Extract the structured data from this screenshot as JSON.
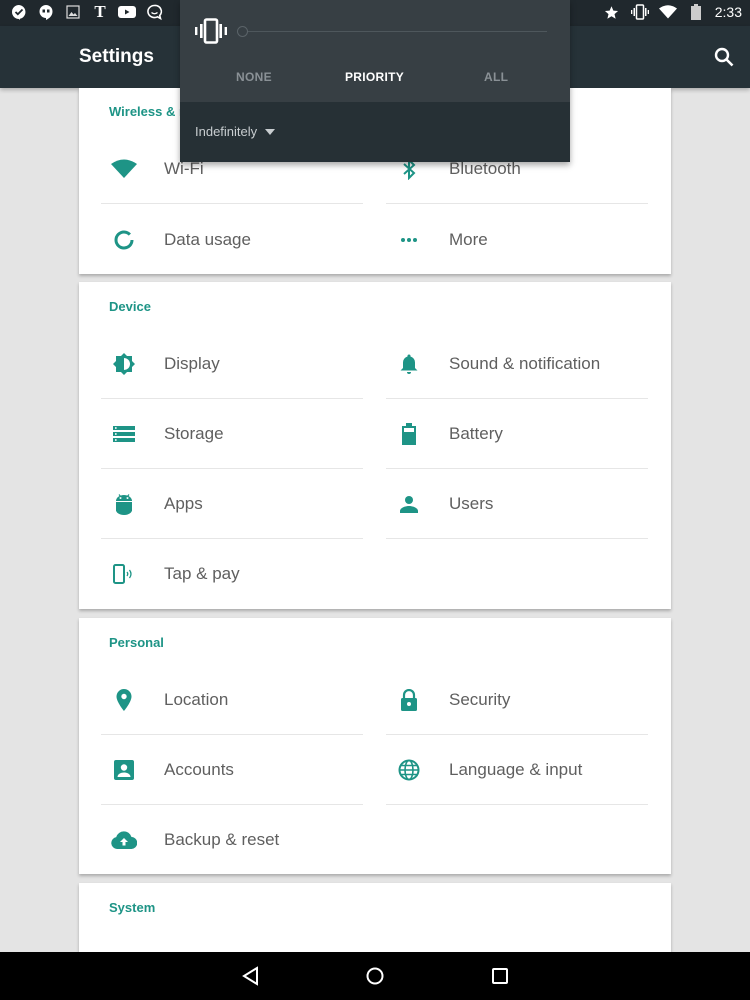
{
  "status_bar": {
    "notification_icons": [
      "inbox-check-icon",
      "hangouts-icon",
      "gallery-icon",
      "nytimes-icon",
      "youtube-icon",
      "chat-bubble-icon"
    ],
    "system_icons": [
      "star-icon",
      "vibrate-icon",
      "wifi-icon",
      "battery-icon"
    ],
    "time": "2:33"
  },
  "app_bar": {
    "title": "Settings",
    "search_icon": "search-icon"
  },
  "volume_panel": {
    "ringer_icon": "vibrate-icon",
    "modes": [
      {
        "label": "NONE",
        "selected": false
      },
      {
        "label": "PRIORITY",
        "selected": true
      },
      {
        "label": "ALL",
        "selected": false
      }
    ],
    "duration_label": "Indefinitely",
    "slider_value": 0
  },
  "sections": [
    {
      "header": "Wireless & networks",
      "header_visible": "Wireless & n",
      "items": [
        {
          "label": "Wi-Fi",
          "icon": "wifi-icon"
        },
        {
          "label": "Bluetooth",
          "icon": "bluetooth-icon"
        },
        {
          "label": "Data usage",
          "icon": "data-usage-icon"
        },
        {
          "label": "More",
          "icon": "more-icon"
        }
      ]
    },
    {
      "header": "Device",
      "items": [
        {
          "label": "Display",
          "icon": "brightness-icon"
        },
        {
          "label": "Sound & notification",
          "icon": "bell-icon"
        },
        {
          "label": "Storage",
          "icon": "storage-icon"
        },
        {
          "label": "Battery",
          "icon": "battery-icon"
        },
        {
          "label": "Apps",
          "icon": "android-icon"
        },
        {
          "label": "Users",
          "icon": "person-icon"
        },
        {
          "label": "Tap & pay",
          "icon": "tap-pay-icon"
        }
      ]
    },
    {
      "header": "Personal",
      "items": [
        {
          "label": "Location",
          "icon": "location-pin-icon"
        },
        {
          "label": "Security",
          "icon": "lock-icon"
        },
        {
          "label": "Accounts",
          "icon": "account-box-icon"
        },
        {
          "label": "Language & input",
          "icon": "globe-icon"
        },
        {
          "label": "Backup & reset",
          "icon": "cloud-upload-icon"
        }
      ]
    },
    {
      "header": "System",
      "items": []
    }
  ],
  "nav_bar": {
    "buttons": [
      "back-icon",
      "home-icon",
      "recents-icon"
    ]
  },
  "colors": {
    "accent": "#1e9486",
    "app_bar": "#263238",
    "status_bar": "#20282d",
    "panel_top": "#373f44",
    "panel_bottom": "#263035"
  }
}
